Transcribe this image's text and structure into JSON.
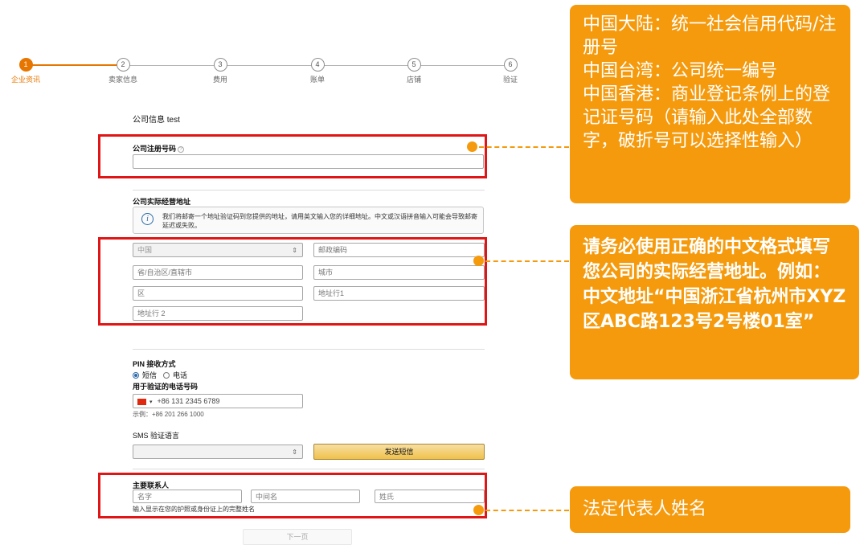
{
  "stepper": {
    "steps": [
      {
        "num": "1",
        "label": "企业资讯"
      },
      {
        "num": "2",
        "label": "卖家信息"
      },
      {
        "num": "3",
        "label": "费用"
      },
      {
        "num": "4",
        "label": "账单"
      },
      {
        "num": "5",
        "label": "店铺"
      },
      {
        "num": "6",
        "label": "验证"
      }
    ],
    "active_step": "1"
  },
  "form": {
    "title": "公司信息 test",
    "reg_number": {
      "label": "公司注册号码",
      "help_icon": "?",
      "value": ""
    },
    "address": {
      "label": "公司实际经营地址",
      "info_icon": "i",
      "info_text": "我们将邮寄一个地址验证码到您提供的地址，请用英文输入您的详细地址。中文或汉语拼音输入可能会导致邮寄延迟或失败。",
      "country": "中国",
      "postal_placeholder": "邮政编码",
      "province_placeholder": "省/自治区/直辖市",
      "city_placeholder": "城市",
      "district_placeholder": "区",
      "address1_placeholder": "地址行1",
      "address2_placeholder": "地址行 2"
    },
    "pin": {
      "label": "PIN 接收方式",
      "option_sms": "短信",
      "option_phone": "电话",
      "phone_label": "用于验证的电话号码",
      "phone_value": "+86 131 2345 6789",
      "example": "示例：+86 201 266 1000",
      "sms_lang_label": "SMS 验证语言",
      "sms_lang_value": "",
      "send_button": "发送短信"
    },
    "contact": {
      "label": "主要联系人",
      "first_name_placeholder": "名字",
      "middle_name_placeholder": "中间名",
      "last_name_placeholder": "姓氏",
      "hint": "输入显示在您的护照或身份证上的完整姓名"
    },
    "next_button": "下一页"
  },
  "callouts": {
    "reg_number": "中国大陆：统一社会信用代码/注册号\n中国台湾：公司统一编号\n中国香港：商业登记条例上的登记证号码（请输入此处全部数字，破折号可以选择性输入）",
    "address": "请务必使用正确的中文格式填写您公司的实际经营地址。例如：中文地址“中国浙江省杭州市XYZ区ABC路123号2号楼01室”",
    "contact": "法定代表人姓名"
  },
  "colors": {
    "accent_orange": "#f59a0c",
    "step_active": "#e77600",
    "highlight_red": "#e01515"
  }
}
